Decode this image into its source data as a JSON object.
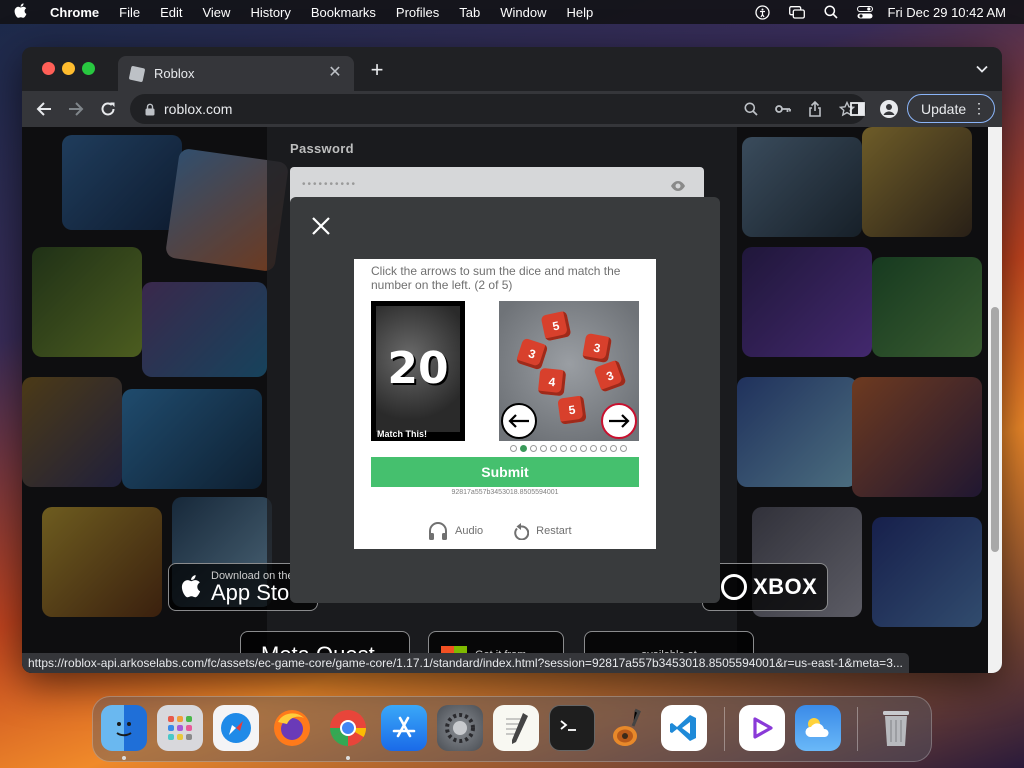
{
  "menubar": {
    "app_name": "Chrome",
    "menus": [
      "File",
      "Edit",
      "View",
      "History",
      "Bookmarks",
      "Profiles",
      "Tab",
      "Window",
      "Help"
    ],
    "clock": "Fri Dec 29  10:42 AM"
  },
  "browser": {
    "tab_title": "Roblox",
    "url": "roblox.com",
    "update_label": "Update",
    "status_url": "https://roblox-api.arkoselabs.com/fc/assets/ec-game-core/game-core/1.17.1/standard/index.html?session=92817a557b3453018.8505594001&r=us-east-1&meta=3..."
  },
  "page": {
    "password_label": "Password",
    "password_mask": "••••••••••",
    "store_badges": [
      {
        "small": "Download on the",
        "big": "App Store"
      },
      {
        "big": "XBOX"
      },
      {
        "small": "Get it from",
        "big": ""
      },
      {
        "small": "available at",
        "big": ""
      },
      {
        "big": "Meta Quest"
      }
    ]
  },
  "captcha": {
    "instructions": "Click the arrows to sum the dice and match the number on the left. (2 of 5)",
    "target_number": "20",
    "target_caption": "Match This!",
    "dice_values": [
      "5",
      "3",
      "3",
      "3",
      "4",
      "5"
    ],
    "progress": {
      "current": 2,
      "total": 12
    },
    "submit_label": "Submit",
    "session_id": "92817a557b3453018.8505594001",
    "audio_label": "Audio",
    "restart_label": "Restart",
    "accent_color": "#45c06e"
  },
  "dock": {
    "apps": [
      "finder-icon",
      "launchpad-icon",
      "safari-icon",
      "firefox-icon",
      "chrome-icon",
      "app-store-icon",
      "system-settings-icon",
      "textedit-icon",
      "terminal-icon",
      "garageband-icon",
      "vscode-icon",
      "visual-studio-icon",
      "weather-icon",
      "trash-icon"
    ]
  }
}
